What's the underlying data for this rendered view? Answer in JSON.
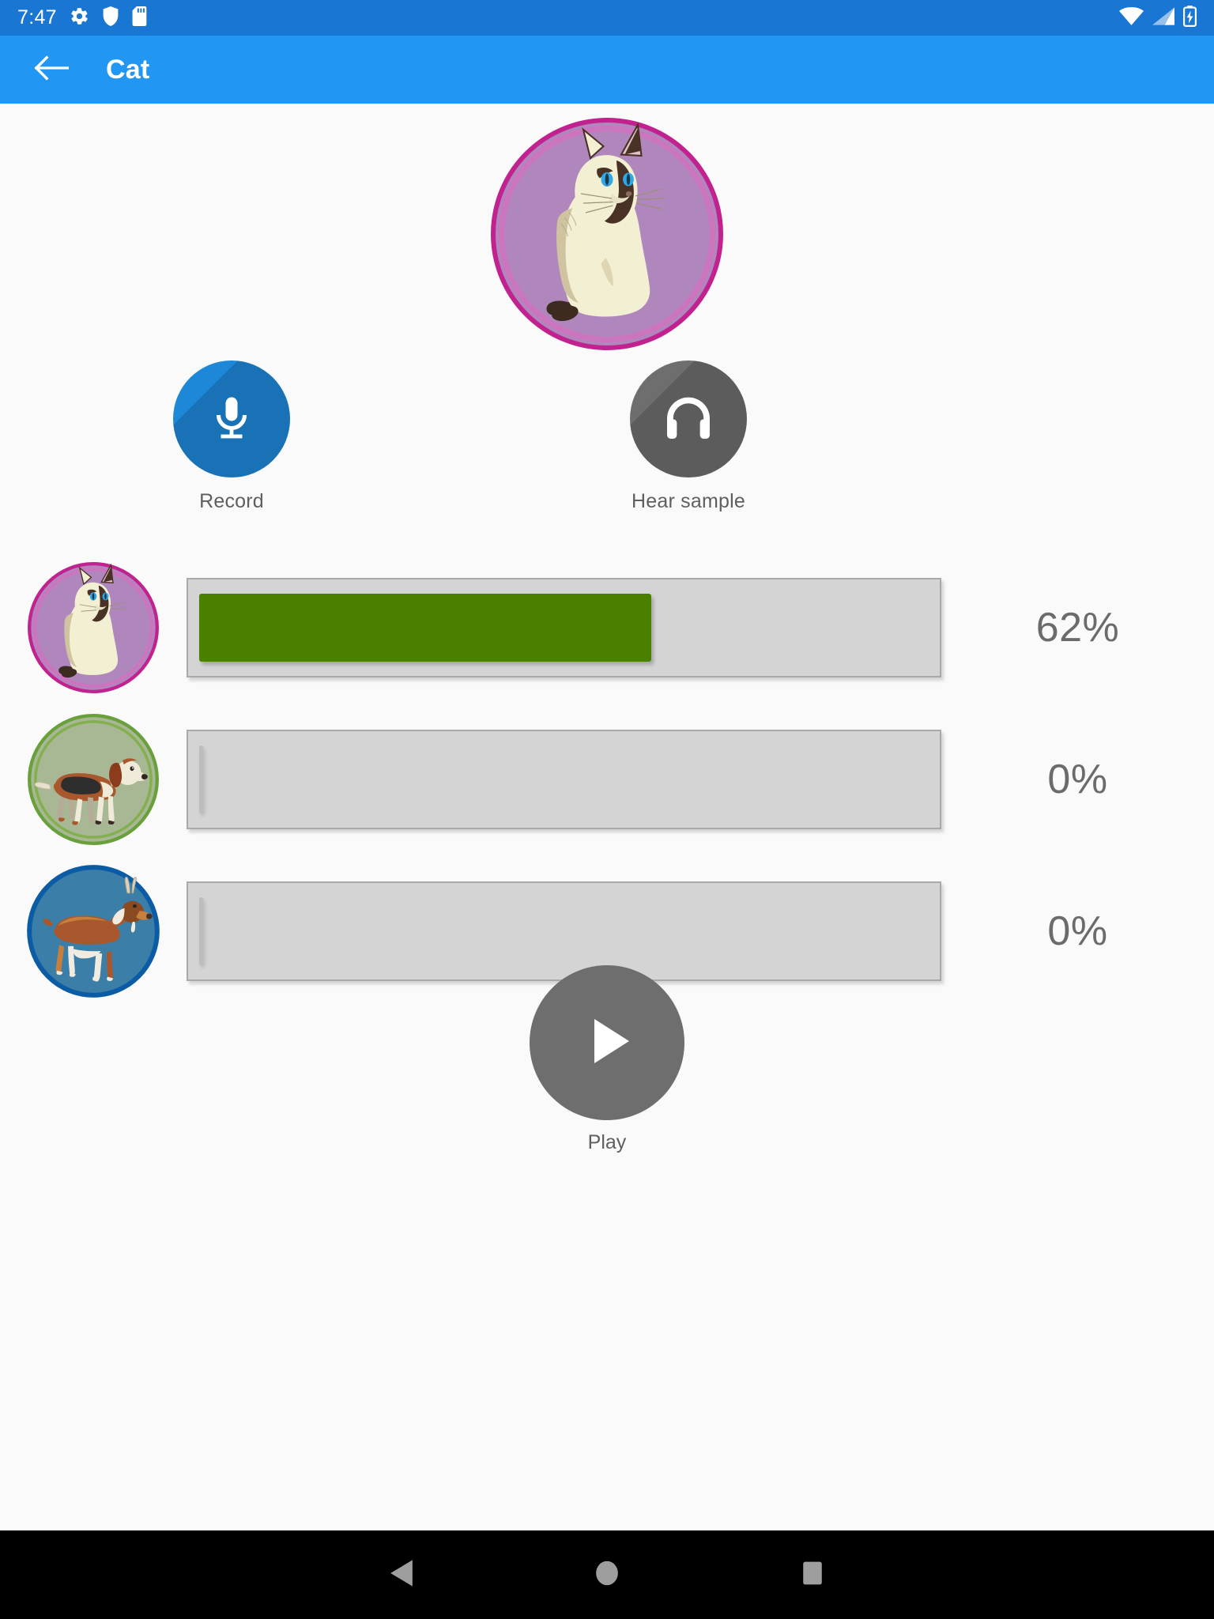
{
  "status_bar": {
    "time": "7:47",
    "left_icons": [
      "gear-icon",
      "shield-icon",
      "sd-card-icon"
    ],
    "right_icons": [
      "wifi-icon",
      "cellular-signal-icon",
      "battery-charging-icon"
    ],
    "background_color": "#1976d2"
  },
  "app_bar": {
    "back_icon": "arrow-left-icon",
    "title": "Cat",
    "background_color": "#2196f3",
    "text_color": "#ffffff"
  },
  "hero": {
    "animal": "cat",
    "icon": "cat-avatar",
    "circle_fill": "#b087bd",
    "circle_border": "#c2228f"
  },
  "actions": [
    {
      "key": "record",
      "label": "Record",
      "icon": "microphone-icon",
      "color": "#1e88d8"
    },
    {
      "key": "hear_sample",
      "label": "Hear sample",
      "icon": "headphones-icon",
      "color": "#6e6e6e"
    }
  ],
  "score_rows": [
    {
      "animal": "cat",
      "icon": "cat-avatar",
      "percent": 62,
      "percent_label": "62%",
      "fill_color": "#4a8000",
      "circle_fill": "#b087bd",
      "circle_border": "#c2228f"
    },
    {
      "animal": "dog",
      "icon": "dog-avatar",
      "percent": 0,
      "percent_label": "0%",
      "fill_color": "#bdbdbd",
      "circle_fill": "#a8b894",
      "circle_border": "#69a03b"
    },
    {
      "animal": "goat",
      "icon": "goat-avatar",
      "percent": 0,
      "percent_label": "0%",
      "fill_color": "#bdbdbd",
      "circle_fill": "#3b7fa8",
      "circle_border": "#0b5ca5"
    }
  ],
  "play": {
    "label": "Play",
    "icon": "play-triangle-icon",
    "color": "#6e6e6e"
  },
  "nav_bar": {
    "background_color": "#000000",
    "buttons": [
      {
        "key": "back",
        "icon": "nav-back-triangle-icon"
      },
      {
        "key": "home",
        "icon": "nav-home-circle-icon"
      },
      {
        "key": "recents",
        "icon": "nav-recents-square-icon"
      }
    ]
  },
  "colors": {
    "track": "#d4d4d4",
    "track_border": "#a9a9a9",
    "progress_green": "#4a8000",
    "page_background": "#fafafa",
    "label_gray": "#5f5f5f",
    "percent_gray": "#6b6b6b"
  }
}
